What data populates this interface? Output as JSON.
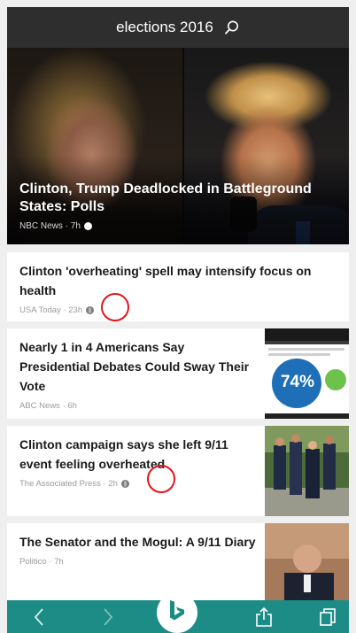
{
  "search": {
    "query": "elections 2016",
    "icon": "search-icon"
  },
  "hero": {
    "title": "Clinton, Trump Deadlocked in Battleground States: Polls",
    "source": "NBC News · 7h"
  },
  "articles": [
    {
      "title": "Clinton 'overheating' spell may intensify focus on health",
      "source": "USA Today · 23h"
    },
    {
      "title": "Nearly 1 in 4 Americans Say Presidential Debates Could Sway Their Vote",
      "source": "ABC News · 6h",
      "thumb_stat": "74%"
    },
    {
      "title": "Clinton campaign says she left 9/11 event feeling overheated",
      "source": "The Associated Press · 2h"
    },
    {
      "title": "The Senator and the Mogul: A 9/11 Diary",
      "source": "Politico · 7h"
    }
  ],
  "toolbar": {
    "back": "chevron-left-icon",
    "forward": "chevron-right-icon",
    "home": "bing-icon",
    "share": "share-icon",
    "tabs": "tabs-icon"
  },
  "colors": {
    "toolbar": "#1d8b86",
    "searchbar": "#2e2e2e",
    "highlight": "#e0161c"
  }
}
